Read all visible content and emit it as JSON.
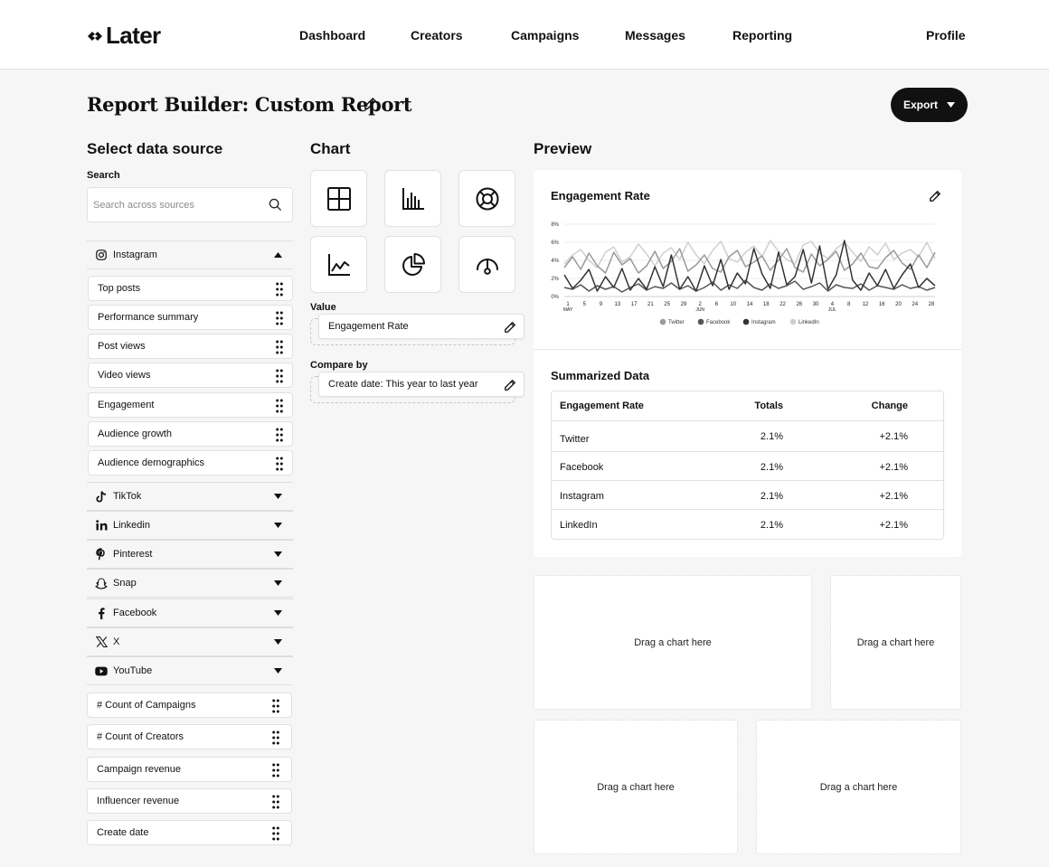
{
  "app": {
    "logo_text": "Later"
  },
  "nav": {
    "items": [
      "Dashboard",
      "Creators",
      "Campaigns",
      "Messages",
      "Reporting"
    ],
    "profile": "Profile"
  },
  "header": {
    "title": "Report Builder: Custom Report",
    "export_label": "Export"
  },
  "data_source": {
    "title": "Select data source",
    "search_label": "Search",
    "search_placeholder": "Search across sources",
    "expanded_source": "Instagram",
    "instagram_fields": [
      "Top posts",
      "Performance summary",
      "Post views",
      "Video views",
      "Engagement",
      "Audience growth",
      "Audience demographics"
    ],
    "collapsed_sources": [
      {
        "label": "TikTok",
        "icon": "tiktok-icon"
      },
      {
        "label": "Linkedin",
        "icon": "linkedin-icon"
      },
      {
        "label": "Pinterest",
        "icon": "pinterest-icon"
      },
      {
        "label": "Snap",
        "icon": "snapchat-icon"
      },
      {
        "label": "Facebook",
        "icon": "facebook-icon"
      },
      {
        "label": "X",
        "icon": "x-icon"
      },
      {
        "label": "YouTube",
        "icon": "youtube-icon"
      }
    ],
    "general_fields": [
      "# Count of Campaigns",
      "# Count of Creators",
      "Campaign revenue",
      "Influencer revenue",
      "Create date"
    ]
  },
  "chart_config": {
    "title": "Chart",
    "chart_types": [
      "table",
      "bar",
      "donut",
      "line",
      "pie",
      "gauge"
    ],
    "value_label": "Value",
    "value": "Engagement Rate",
    "compare_label": "Compare by",
    "compare": "Create date: This year to last year"
  },
  "preview": {
    "title": "Preview",
    "chart_title": "Engagement Rate",
    "summary_title": "Summarized Data",
    "table": {
      "headers": [
        "Engagement Rate",
        "Totals",
        "Change"
      ],
      "rows": [
        [
          "Twitter",
          "2.1%",
          "+2.1%"
        ],
        [
          "Facebook",
          "2.1%",
          "+2.1%"
        ],
        [
          "Instagram",
          "2.1%",
          "+2.1%"
        ],
        [
          "LinkedIn",
          "2.1%",
          "+2.1%"
        ]
      ]
    },
    "drop_label": "Drag a chart here"
  },
  "colors": {
    "brand": "#111111",
    "background": "#f6f6f6"
  },
  "chart_data": {
    "type": "line",
    "title": "Engagement Rate",
    "xlabel": "",
    "ylabel": "",
    "ylim": [
      0,
      8
    ],
    "ytick_labels": [
      "0%",
      "2%",
      "4%",
      "6%",
      "8%"
    ],
    "xtick_labels": [
      "1",
      "5",
      "9",
      "13",
      "17",
      "21",
      "25",
      "29",
      "2",
      "6",
      "10",
      "14",
      "18",
      "22",
      "26",
      "30",
      "4",
      "8",
      "12",
      "16",
      "20",
      "24",
      "28"
    ],
    "month_labels": [
      {
        "label": "MAY",
        "tick": 0
      },
      {
        "label": "JUN",
        "tick": 8
      },
      {
        "label": "JUL",
        "tick": 16
      }
    ],
    "legend_position": "bottom",
    "series": [
      {
        "name": "Twitter",
        "color": "#9a9a9a",
        "values": [
          3.2,
          4.4,
          3.0,
          4.8,
          3.4,
          2.6,
          4.9,
          3.5,
          4.2,
          2.6,
          3.4,
          5.0,
          3.1,
          3.9,
          5.3,
          2.8,
          3.5,
          4.6,
          3.1,
          2.7,
          4.4,
          5.1,
          3.3,
          3.8,
          4.5,
          2.9,
          4.0,
          5.3,
          3.2,
          2.7,
          4.7,
          3.4,
          4.1,
          5.0,
          2.9,
          3.6,
          4.8,
          3.3,
          3.1,
          4.3,
          5.1,
          3.7,
          3.0,
          4.6,
          3.2,
          4.9
        ]
      },
      {
        "name": "Facebook",
        "color": "#555555",
        "values": [
          1.0,
          0.8,
          1.3,
          0.6,
          1.2,
          0.8,
          1.1,
          0.5,
          1.0,
          1.4,
          0.7,
          1.1,
          0.9,
          1.5,
          0.8,
          1.2,
          0.6,
          1.0,
          1.6,
          0.7,
          1.3,
          0.9,
          1.8,
          1.0,
          0.7,
          1.4,
          0.9,
          1.2,
          1.7,
          0.8,
          1.1,
          1.5,
          0.6,
          1.3,
          1.0,
          0.9,
          1.4,
          0.7,
          1.2,
          1.0,
          0.8,
          1.3,
          0.9,
          1.1,
          0.7,
          1.0
        ]
      },
      {
        "name": "Instagram",
        "color": "#333333",
        "values": [
          2.4,
          0.9,
          1.8,
          3.0,
          0.6,
          2.2,
          1.0,
          3.1,
          0.7,
          2.0,
          0.8,
          3.3,
          1.1,
          4.6,
          0.8,
          2.2,
          0.6,
          3.4,
          1.2,
          4.1,
          0.8,
          2.6,
          1.4,
          5.3,
          2.5,
          0.9,
          4.9,
          1.3,
          2.2,
          5.2,
          1.5,
          5.6,
          0.8,
          2.4,
          6.2,
          1.8,
          0.7,
          2.6,
          1.2,
          3.0,
          0.9,
          2.4,
          3.6,
          1.0,
          2.0,
          1.2
        ]
      },
      {
        "name": "LinkedIn",
        "color": "#cfcfcf",
        "values": [
          3.6,
          4.6,
          5.2,
          4.0,
          3.2,
          4.9,
          5.5,
          3.8,
          4.4,
          5.8,
          4.7,
          3.4,
          4.8,
          5.4,
          4.1,
          6.0,
          4.6,
          3.6,
          5.1,
          6.1,
          4.2,
          3.8,
          4.9,
          5.6,
          4.4,
          6.2,
          5.0,
          4.1,
          3.6,
          5.7,
          6.1,
          4.8,
          4.2,
          5.3,
          6.0,
          4.9,
          3.9,
          5.5,
          4.6,
          5.9,
          4.1,
          4.8,
          5.2,
          4.4,
          6.0,
          4.2
        ]
      }
    ]
  }
}
